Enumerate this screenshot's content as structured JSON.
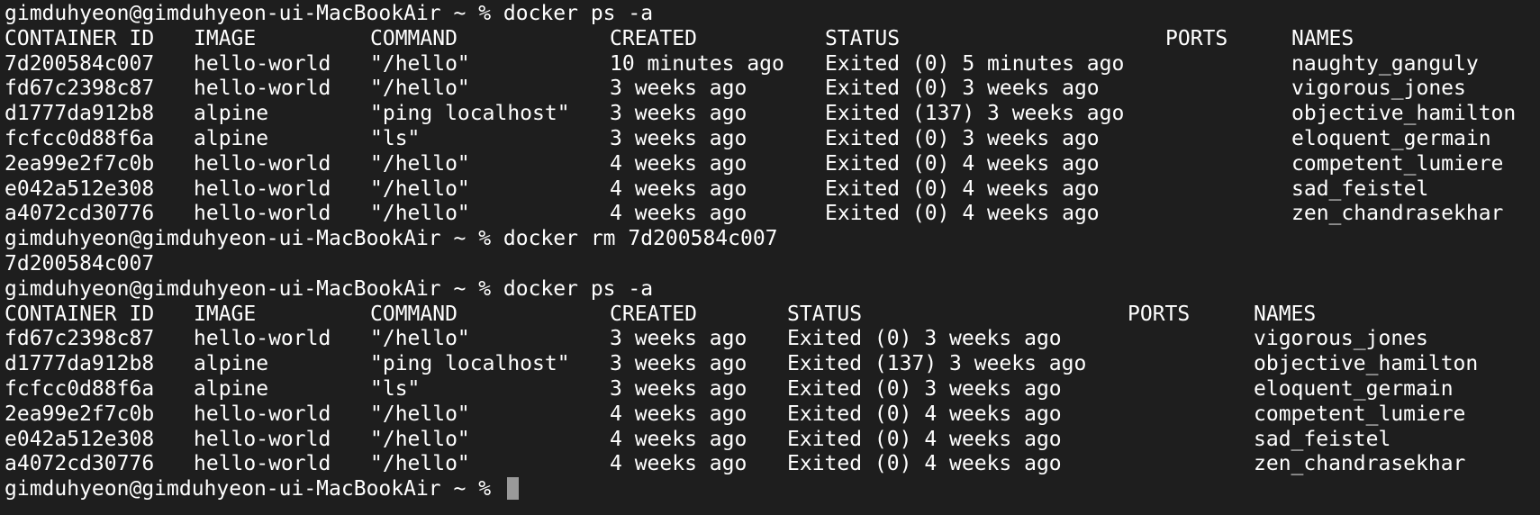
{
  "colors": {
    "background": "#1e1e1e",
    "text": "#ffffff",
    "cursor": "#9a9a9a"
  },
  "prompt": "gimduhyeon@gimduhyeon-ui-MacBookAir ~ % ",
  "commands": {
    "first": "docker ps -a",
    "second": "docker rm 7d200584c007",
    "third": "docker ps -a"
  },
  "rm_output": "7d200584c007",
  "headers": {
    "container_id": "CONTAINER ID",
    "image": "IMAGE",
    "command": "COMMAND",
    "created": "CREATED",
    "status": "STATUS",
    "ports": "PORTS",
    "names": "NAMES"
  },
  "listing1": [
    {
      "id": "7d200584c007",
      "image": "hello-world",
      "command": "\"/hello\"",
      "created": "10 minutes ago",
      "status": "Exited (0) 5 minutes ago",
      "ports": "",
      "names": "naughty_ganguly"
    },
    {
      "id": "fd67c2398c87",
      "image": "hello-world",
      "command": "\"/hello\"",
      "created": "3 weeks ago",
      "status": "Exited (0) 3 weeks ago",
      "ports": "",
      "names": "vigorous_jones"
    },
    {
      "id": "d1777da912b8",
      "image": "alpine",
      "command": "\"ping localhost\"",
      "created": "3 weeks ago",
      "status": "Exited (137) 3 weeks ago",
      "ports": "",
      "names": "objective_hamilton"
    },
    {
      "id": "fcfcc0d88f6a",
      "image": "alpine",
      "command": "\"ls\"",
      "created": "3 weeks ago",
      "status": "Exited (0) 3 weeks ago",
      "ports": "",
      "names": "eloquent_germain"
    },
    {
      "id": "2ea99e2f7c0b",
      "image": "hello-world",
      "command": "\"/hello\"",
      "created": "4 weeks ago",
      "status": "Exited (0) 4 weeks ago",
      "ports": "",
      "names": "competent_lumiere"
    },
    {
      "id": "e042a512e308",
      "image": "hello-world",
      "command": "\"/hello\"",
      "created": "4 weeks ago",
      "status": "Exited (0) 4 weeks ago",
      "ports": "",
      "names": "sad_feistel"
    },
    {
      "id": "a4072cd30776",
      "image": "hello-world",
      "command": "\"/hello\"",
      "created": "4 weeks ago",
      "status": "Exited (0) 4 weeks ago",
      "ports": "",
      "names": "zen_chandrasekhar"
    }
  ],
  "listing2": [
    {
      "id": "fd67c2398c87",
      "image": "hello-world",
      "command": "\"/hello\"",
      "created": "3 weeks ago",
      "status": "Exited (0) 3 weeks ago",
      "ports": "",
      "names": "vigorous_jones"
    },
    {
      "id": "d1777da912b8",
      "image": "alpine",
      "command": "\"ping localhost\"",
      "created": "3 weeks ago",
      "status": "Exited (137) 3 weeks ago",
      "ports": "",
      "names": "objective_hamilton"
    },
    {
      "id": "fcfcc0d88f6a",
      "image": "alpine",
      "command": "\"ls\"",
      "created": "3 weeks ago",
      "status": "Exited (0) 3 weeks ago",
      "ports": "",
      "names": "eloquent_germain"
    },
    {
      "id": "2ea99e2f7c0b",
      "image": "hello-world",
      "command": "\"/hello\"",
      "created": "4 weeks ago",
      "status": "Exited (0) 4 weeks ago",
      "ports": "",
      "names": "competent_lumiere"
    },
    {
      "id": "e042a512e308",
      "image": "hello-world",
      "command": "\"/hello\"",
      "created": "4 weeks ago",
      "status": "Exited (0) 4 weeks ago",
      "ports": "",
      "names": "sad_feistel"
    },
    {
      "id": "a4072cd30776",
      "image": "hello-world",
      "command": "\"/hello\"",
      "created": "4 weeks ago",
      "status": "Exited (0) 4 weeks ago",
      "ports": "",
      "names": "zen_chandrasekhar"
    }
  ]
}
